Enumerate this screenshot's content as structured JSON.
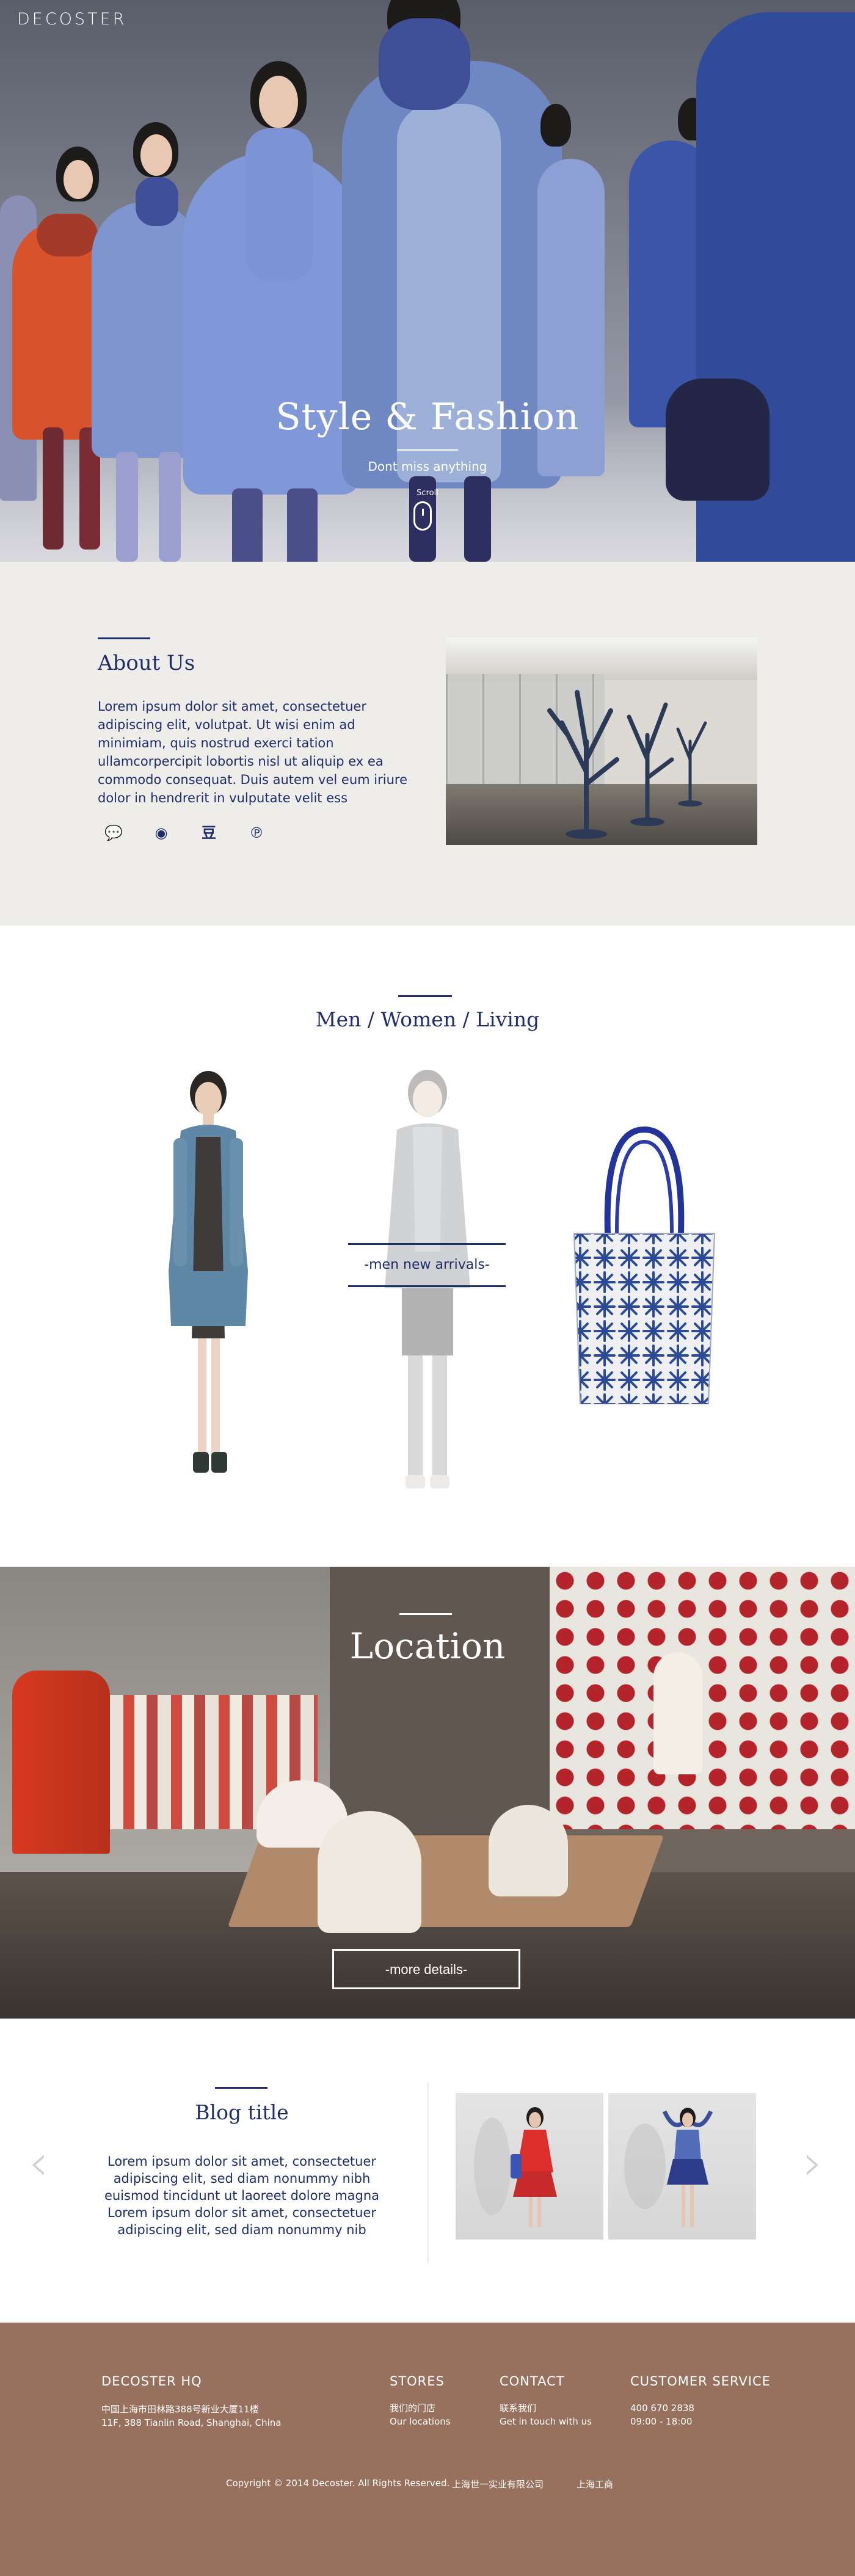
{
  "brand": {
    "logo": "DECOSTER"
  },
  "hero": {
    "title": "Style & Fashion",
    "subtitle": "Dont miss anything",
    "scroll_label": "Scroll"
  },
  "about": {
    "title": "About Us",
    "text": "Lorem ipsum dolor sit amet, consectetuer adipiscing elit, volutpat. Ut wisi enim ad minimiam, quis nostrud exerci tation ullamcorpercipit lobortis nisl ut aliquip ex ea commodo consequat. Duis autem vel eum iriure dolor in hendrerit in vulputate velit ess",
    "social_icons": [
      "wechat-icon",
      "weibo-icon",
      "douban-icon",
      "pinterest-icon"
    ],
    "social_glyphs": [
      "💬",
      "◉",
      "豆",
      "℗"
    ]
  },
  "collection": {
    "title": "Men / Women / Living",
    "arrivals_label": "-men new arrivals-"
  },
  "location": {
    "title": "Location",
    "button": "-more details-"
  },
  "blog": {
    "title": "Blog title",
    "text": "Lorem ipsum dolor sit amet, consectetuer adipiscing elit, sed diam nonummy nibh euismod tincidunt ut laoreet dolore magna Lorem ipsum dolor sit amet, consectetuer adipiscing elit, sed diam nonummy nib",
    "prev": "‹",
    "next": "›"
  },
  "footer": {
    "hq_title": "DECOSTER HQ",
    "hq_address_cn": "中国上海市田林路388号新业大厦11楼",
    "hq_address_en": "11F, 388 Tianlin Road, Shanghai, China",
    "stores_title": "STORES",
    "stores_cn": "我们的门店",
    "stores_en": "Our locations",
    "contact_title": "CONTACT",
    "contact_cn": "联系我们",
    "contact_en": "Get in touch with us",
    "service_title": "CUSTOMER SERVICE",
    "service_phone": "400 670 2838",
    "service_hours": "09:00 - 18:00",
    "copyright": "Copyright © 2014  Decoster. All Rights Reserved.",
    "company_cn": "上海世一实业有限公司",
    "icp": "上海工商"
  },
  "colors": {
    "navy": "#1f2d6b",
    "footer_brown": "#97705e",
    "about_bg": "#eeedea"
  }
}
